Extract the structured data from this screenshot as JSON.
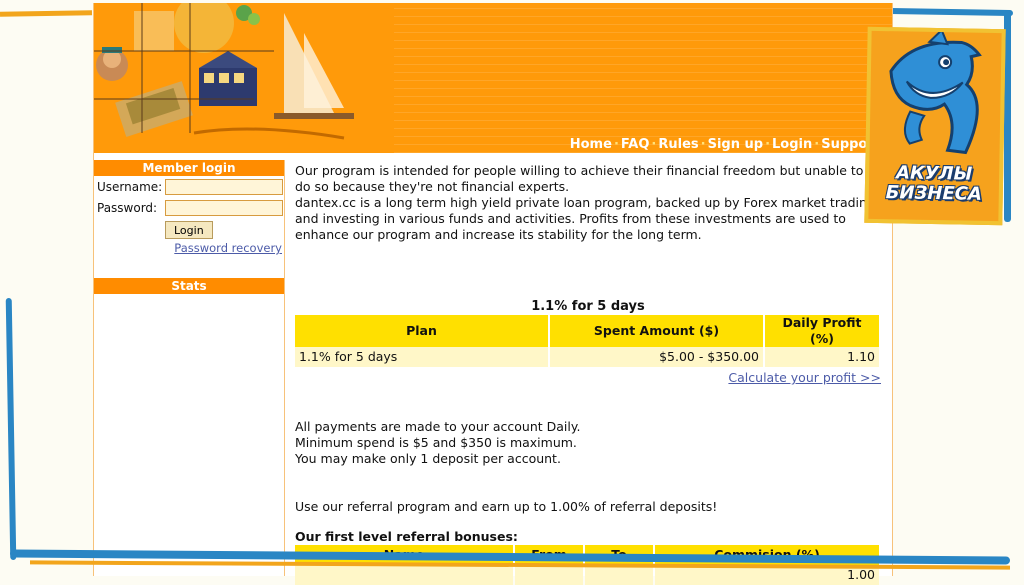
{
  "nav": {
    "items": [
      "Home",
      "FAQ",
      "Rules",
      "Sign up",
      "Login",
      "Support"
    ],
    "separator": "·"
  },
  "sidebar": {
    "member_login_title": "Member login",
    "username_label": "Username:",
    "password_label": "Password:",
    "login_button": "Login",
    "password_recovery": "Password recovery",
    "stats_title": "Stats"
  },
  "main": {
    "intro_1": "Our program is intended for people willing to achieve their financial freedom but unable to do so because they're not financial experts.",
    "intro_2": "dantex.cc is a long term high yield private loan program, backed up by Forex market trading and investing in various funds and activities. Profits from these investments are used to enhance our program and increase its stability for the long term.",
    "plan_title": "1.1% for 5 days",
    "plan_table": {
      "headers": [
        "Plan",
        "Spent Amount ($)",
        "Daily Profit (%)"
      ],
      "rows": [
        [
          "1.1% for 5 days",
          "$5.00 - $350.00",
          "1.10"
        ]
      ]
    },
    "calc_link": "Calculate your profit >>",
    "payments_1": "All payments are made to your account Daily.",
    "payments_2": "Minimum spend is $5 and $350 is maximum.",
    "payments_3": "You may make only 1 deposit per account.",
    "referral_text": "Use our referral program and earn up to 1.00% of referral deposits!",
    "referral_title": "Our first level referral bonuses:",
    "referral_table": {
      "headers": [
        "Name",
        "From",
        "To",
        "Commision (%)"
      ],
      "rows": [
        [
          "",
          "",
          "",
          "1.00"
        ]
      ]
    }
  },
  "badge": {
    "line1": "АКУЛЫ",
    "line2": "БИЗНЕСА"
  },
  "colors": {
    "header_orange": "#ff9a0a",
    "table_header_yellow": "#ffe000",
    "badge_blue": "#2a86c4"
  }
}
